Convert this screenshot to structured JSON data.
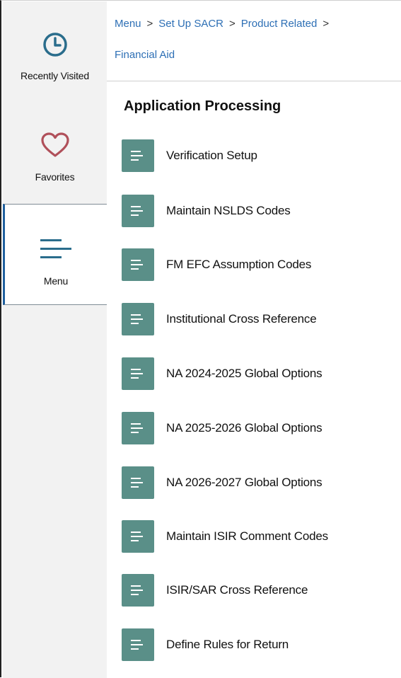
{
  "rail": {
    "recent_label": "Recently Visited",
    "favorites_label": "Favorites",
    "menu_label": "Menu",
    "icons": {
      "recent": "clock-icon",
      "favorites": "heart-icon",
      "menu": "hamburger-menu-icon"
    }
  },
  "breadcrumb": {
    "items": [
      "Menu",
      "Set Up SACR",
      "Product Related",
      "Financial Aid"
    ],
    "separator": ">"
  },
  "section_title": "Application Processing",
  "menu_items": [
    "Verification Setup",
    "Maintain NSLDS Codes",
    "FM EFC Assumption Codes",
    "Institutional Cross Reference",
    "NA 2024-2025 Global Options",
    "NA 2025-2026 Global Options",
    "NA 2026-2027 Global Options",
    "Maintain ISIR Comment Codes",
    "ISIR/SAR Cross Reference",
    "Define Rules for Return"
  ],
  "colors": {
    "accent_teal": "#5a8f88",
    "link_blue": "#2d6fb5",
    "rail_bg": "#f2f2f2",
    "selected_bar": "#1f5f9e"
  }
}
